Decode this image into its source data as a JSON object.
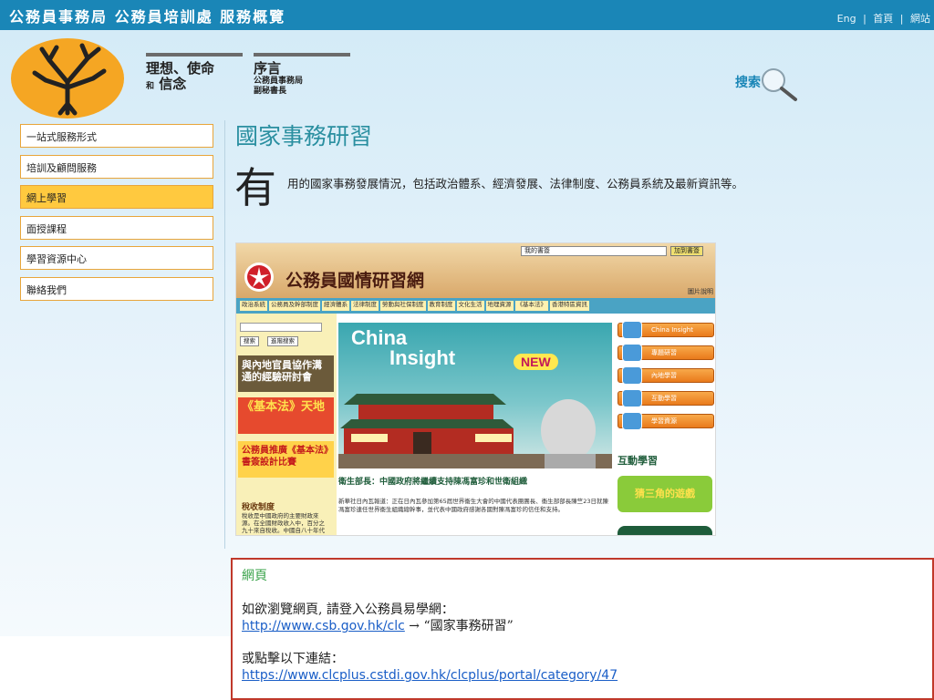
{
  "header": {
    "site_title": "公務員事務局 公務員培訓處 服務概覽",
    "links": [
      "Eng",
      "首頁",
      "網站"
    ],
    "separator": "|"
  },
  "logo": {
    "icon": "tree-icon",
    "color": "#f5a623"
  },
  "nav_tabs": {
    "mission": {
      "line1": "理想、使命",
      "line2_small": "和",
      "line2": "信念"
    },
    "preface": {
      "line1": "序言",
      "line2": "公務員事務局",
      "line3": "副秘書長"
    }
  },
  "search": {
    "label": "搜索"
  },
  "sidebar": {
    "items": [
      {
        "label": "一站式服務形式",
        "active": false
      },
      {
        "label": "培訓及顧問服務",
        "active": false
      },
      {
        "label": "網上學習",
        "active": true
      },
      {
        "label": "面授課程",
        "active": false
      },
      {
        "label": "學習資源中心",
        "active": false
      },
      {
        "label": "聯絡我們",
        "active": false
      }
    ]
  },
  "main": {
    "heading": "國家事務研習",
    "dropcap": "有",
    "intro": "用的國家事務發展情況，包括政治體系、經濟發展、法律制度、公務員系統及最新資訊等。"
  },
  "embed": {
    "select_value": "我的書簽",
    "add_bookmark": "加到書簽",
    "site_title": "公務員國情研習網",
    "caption": "圖片說明",
    "nav": [
      "政治系統",
      "公務員及幹部制度",
      "經濟體系",
      "法律制度",
      "勞動與社保制度",
      "教育制度",
      "文化生活",
      "地理資源",
      "《基本法》",
      "香港特區資訊"
    ],
    "search_btn": "搜索",
    "advanced_btn": "進階搜索",
    "banner1": "與內地官員協作溝通的經驗研討會",
    "banner2": "《基本法》天地",
    "banner3": "公務員推廣《基本法》書簽設計比賽",
    "tax_title": "稅收制度",
    "tax_text": "稅收是中國政府的主要財政來源。在全國財政收入中，百分之九十來自稅收。中國自八十年代",
    "hero_line1": "China",
    "hero_line2": "Insight",
    "hero_badge": "NEW",
    "headline": "衛生部長：中國政府將繼續支持陳馮富珍和世衛組織",
    "body": "新華社日內瓦報道：正在日內瓦參加第65屆世界衞生大會的中國代表團團長、衞生部部長陳竺23日就陳馮富珍連任世界衞生組織總幹事，並代表中國政府感謝各國對陳馮富珍的信任和支持。",
    "right_buttons": [
      "China Insight",
      "專題研習",
      "內地學習",
      "互動學習",
      "學習資源"
    ],
    "interactive_label": "互動學習",
    "game_label": "猜三角的遊戲"
  },
  "info": {
    "title": "網頁",
    "line1": "如欲瀏覽網頁, 請登入公務員易學網：",
    "link1": "http://www.csb.gov.hk/clc",
    "arrow": " → “國家事務研習”",
    "line2": "或點擊以下連結：",
    "link2": "https://www.clcplus.cstdi.gov.hk/clcplus/portal/category/47"
  },
  "colors": {
    "header": "#1a86b7",
    "accent_orange": "#e8a53a",
    "active_bg": "#ffc93f",
    "heading": "#2a8fa0",
    "link": "#1a5ec7",
    "info_border": "#c0392b"
  }
}
